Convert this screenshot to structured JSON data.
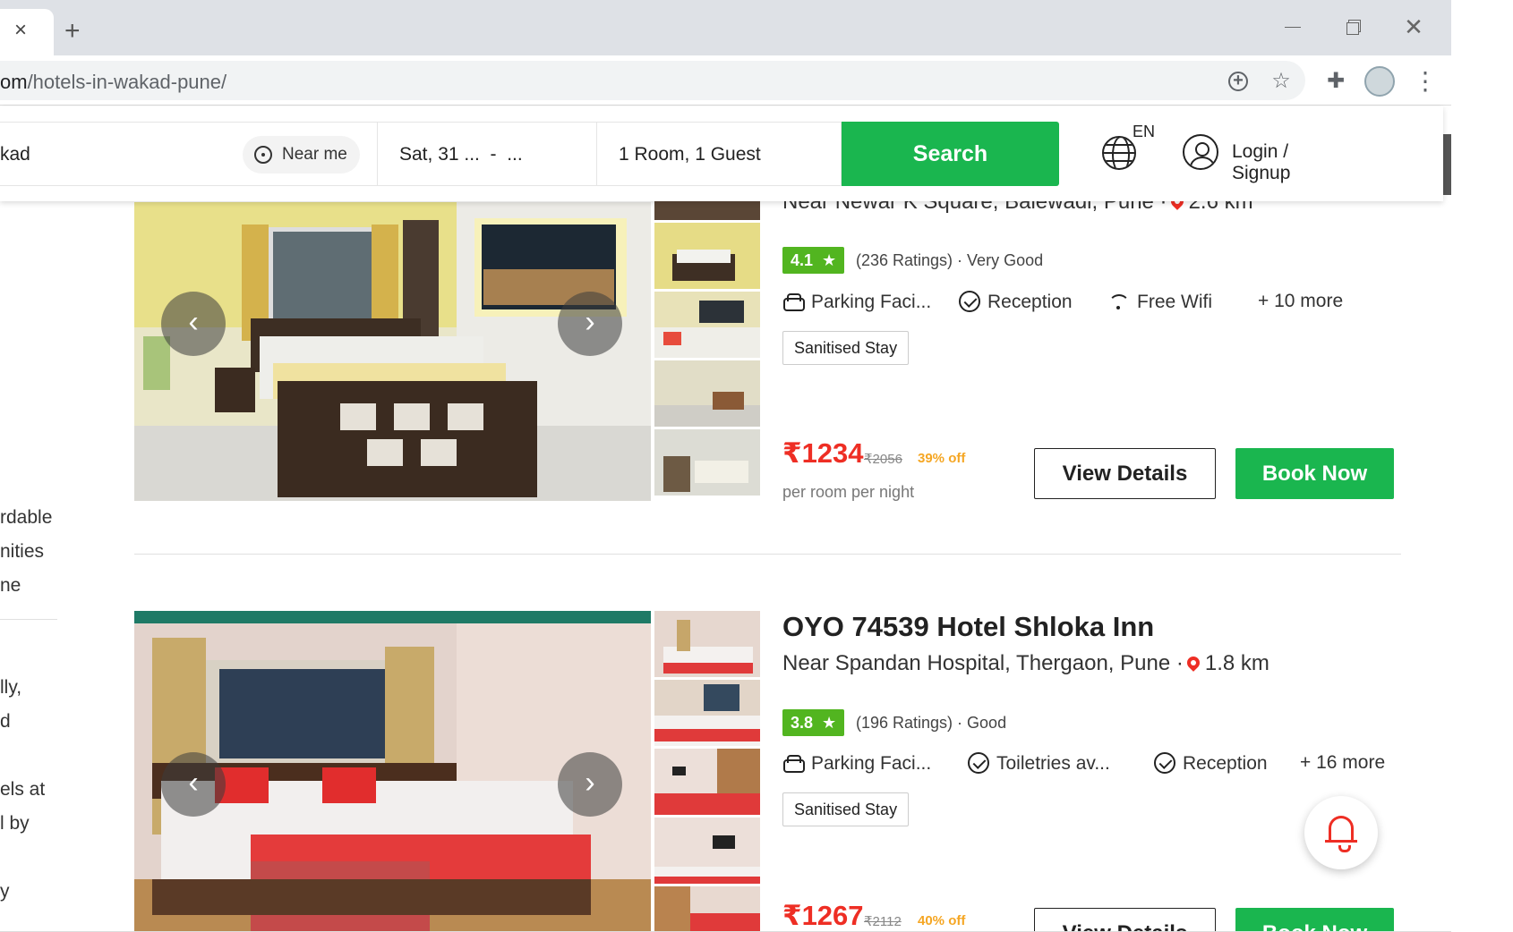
{
  "browser": {
    "tab_close": "×",
    "new_tab": "+",
    "url_prefix": "om",
    "url_path": "/hotels-in-wakad-pune/",
    "close_glyph": "✕",
    "star_glyph": "☆",
    "puzzle_glyph": "✚",
    "menu_glyph": "⋮"
  },
  "search": {
    "city_value": "kad",
    "near_me_label": "Near me",
    "date_value": "Sat, 31 ...  -  ...",
    "guests_value": "1 Room, 1 Guest",
    "search_label": "Search"
  },
  "header": {
    "language": "EN",
    "login_label": "Login / Signup"
  },
  "sidebar": {
    "lines": [
      "rdable",
      "nities",
      "ne",
      "lly,",
      "d",
      "els at",
      "l by",
      "y"
    ]
  },
  "hotels": [
    {
      "address": "Near Newar K Square, Balewadi, Pune ·",
      "distance": "2.6 km",
      "rating": "4.1",
      "rating_text": "(236 Ratings) · Very Good",
      "amenities": [
        "Parking Faci...",
        "Reception",
        "Free Wifi",
        "+ 10 more"
      ],
      "tag": "Sanitised Stay",
      "price": "₹1234",
      "old_price": "₹2056",
      "discount": "39% off",
      "per_night": "per room per night",
      "view_label": "View Details",
      "book_label": "Book Now"
    },
    {
      "name": "OYO 74539 Hotel Shloka Inn",
      "address": "Near Spandan Hospital, Thergaon, Pune ·",
      "distance": "1.8 km",
      "rating": "3.8",
      "rating_text": "(196 Ratings) · Good",
      "amenities": [
        "Parking Faci...",
        "Toiletries av...",
        "Reception",
        "+ 16 more"
      ],
      "tag": "Sanitised Stay",
      "price": "₹1267",
      "old_price": "₹2112",
      "discount": "40% off",
      "view_label": "View Details",
      "book_label": "Book Now"
    }
  ],
  "icons": {
    "arrow_left": "‹",
    "arrow_right": "›",
    "star": "★"
  },
  "colors": {
    "brand_green": "#1ab64f",
    "rating_green": "#52b520",
    "price_red": "#ee2e24",
    "discount_orange": "#f5a623"
  }
}
